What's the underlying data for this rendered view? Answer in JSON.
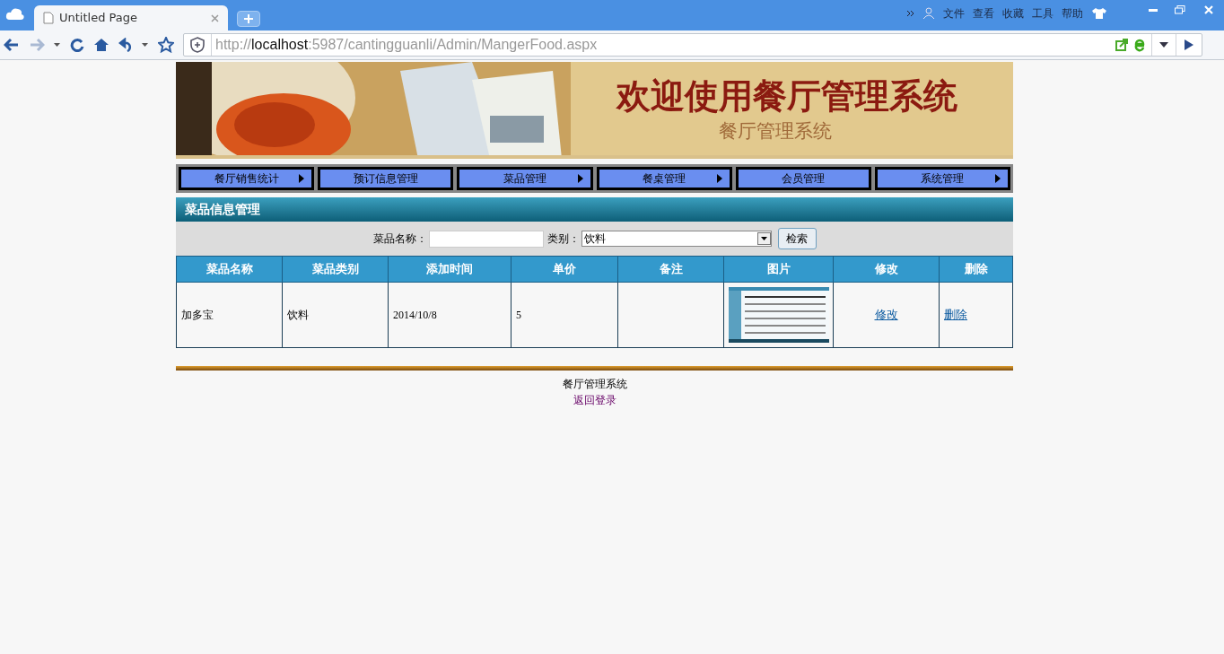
{
  "browser": {
    "tab_title": "Untitled Page",
    "menu": [
      "文件",
      "查看",
      "收藏",
      "工具",
      "帮助"
    ],
    "url_scheme": "http://",
    "url_host": "localhost",
    "url_rest": ":5987/cantingguanli/Admin/MangerFood.aspx"
  },
  "banner": {
    "title": "欢迎使用餐厅管理系统",
    "subtitle": "餐厅管理系统"
  },
  "nav": [
    {
      "label": "餐厅销售统计",
      "has_submenu": true
    },
    {
      "label": "预订信息管理",
      "has_submenu": false
    },
    {
      "label": "菜品管理",
      "has_submenu": true
    },
    {
      "label": "餐桌管理",
      "has_submenu": true
    },
    {
      "label": "会员管理",
      "has_submenu": false
    },
    {
      "label": "系统管理",
      "has_submenu": true
    }
  ],
  "section_title": "菜品信息管理",
  "search": {
    "name_label": "菜品名称：",
    "category_label": "类别：",
    "category_value": "饮料",
    "button": "检索"
  },
  "table": {
    "columns": [
      "菜品名称",
      "菜品类别",
      "添加时间",
      "单价",
      "备注",
      "图片",
      "修改",
      "删除"
    ],
    "rows": [
      {
        "name": "加多宝",
        "category": "饮料",
        "added": "2014/10/8",
        "price": "5",
        "edit": "修改",
        "delete": "删除"
      }
    ]
  },
  "footer": {
    "text": "餐厅管理系统",
    "link": "返回登录"
  }
}
